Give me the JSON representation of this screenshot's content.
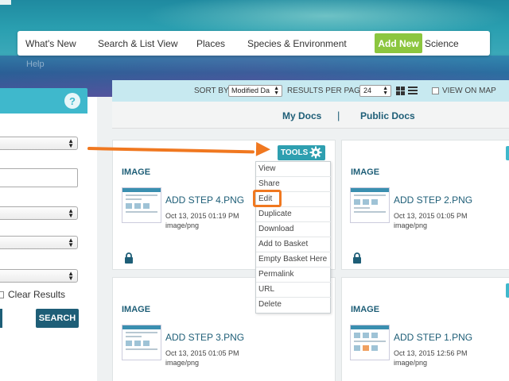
{
  "nav": {
    "items": [
      "What's New",
      "Search & List View",
      "Places",
      "Species & Environment",
      "Add New",
      "Science"
    ],
    "help": "Help"
  },
  "sidebar": {
    "help_icon": "?",
    "clear_results": "Clear Results",
    "search_button": "SEARCH"
  },
  "toolbar": {
    "sort_by_label": "SORT BY",
    "sort_value": "Modified Da",
    "results_per_page_label": "RESULTS PER PAGE",
    "results_per_page_value": "24",
    "view_on_map_label": "VIEW ON MAP"
  },
  "tabs": {
    "my_docs": "My Docs",
    "separator": "|",
    "public_docs": "Public Docs"
  },
  "tools": {
    "label": "TOOLS",
    "menu": [
      "View",
      "Share",
      "Edit",
      "Duplicate",
      "Download",
      "Add to Basket",
      "Empty Basket Here",
      "Permalink",
      "URL",
      "Delete"
    ]
  },
  "cards": [
    {
      "type": "IMAGE",
      "title": "ADD STEP 4.PNG",
      "date": "Oct 13, 2015 01:19 PM",
      "mime": "image/png"
    },
    {
      "type": "IMAGE",
      "title": "ADD STEP 2.PNG",
      "date": "Oct 13, 2015 01:05 PM",
      "mime": "image/png"
    },
    {
      "type": "IMAGE",
      "title": "ADD STEP 3.PNG",
      "date": "Oct 13, 2015 01:05 PM",
      "mime": "image/png"
    },
    {
      "type": "IMAGE",
      "title": "ADD STEP 1.PNG",
      "date": "Oct 13, 2015 12:56 PM",
      "mime": "image/png"
    }
  ],
  "colors": {
    "accent": "#3fb8cc",
    "add_new": "#8cc63f",
    "highlight": "#f07820",
    "link": "#1e5e77"
  }
}
